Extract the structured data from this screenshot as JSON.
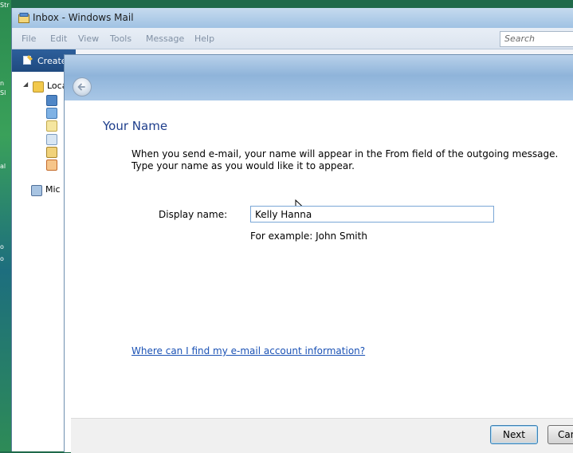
{
  "desktop": {
    "fragments": [
      "Str",
      "n",
      "Sl",
      "al",
      "o",
      "o"
    ]
  },
  "mail_window": {
    "title": "Inbox - Windows Mail",
    "menu": [
      "File",
      "Edit",
      "View",
      "Tools",
      "Message",
      "Help"
    ],
    "search_placeholder": "Search",
    "create_label": "Create",
    "folders": [
      {
        "label": "Loca",
        "icon": "folder-icon"
      },
      {
        "label": "",
        "icon": "inbox-icon"
      },
      {
        "label": "",
        "icon": "outbox-icon"
      },
      {
        "label": "",
        "icon": "sent-icon"
      },
      {
        "label": "",
        "icon": "deleted-icon"
      },
      {
        "label": "",
        "icon": "drafts-icon"
      },
      {
        "label": "",
        "icon": "junk-icon"
      },
      {
        "label": "Mic",
        "icon": "newsgroup-icon"
      }
    ]
  },
  "wizard": {
    "heading": "Your Name",
    "intro_line1": "When you send e-mail, your name will appear in the From field of the outgoing message.",
    "intro_line2": "Type your name as you would like it to appear.",
    "display_label": "Display name:",
    "display_value": "Kelly Hanna",
    "example": "For example: John Smith",
    "help_link": "Where can I find my e-mail account information?",
    "next_label": "Next",
    "cancel_label": "Can"
  },
  "colors": {
    "heading": "#1e3e8c",
    "link": "#1b52b5",
    "glass": "#9fc2e3"
  }
}
